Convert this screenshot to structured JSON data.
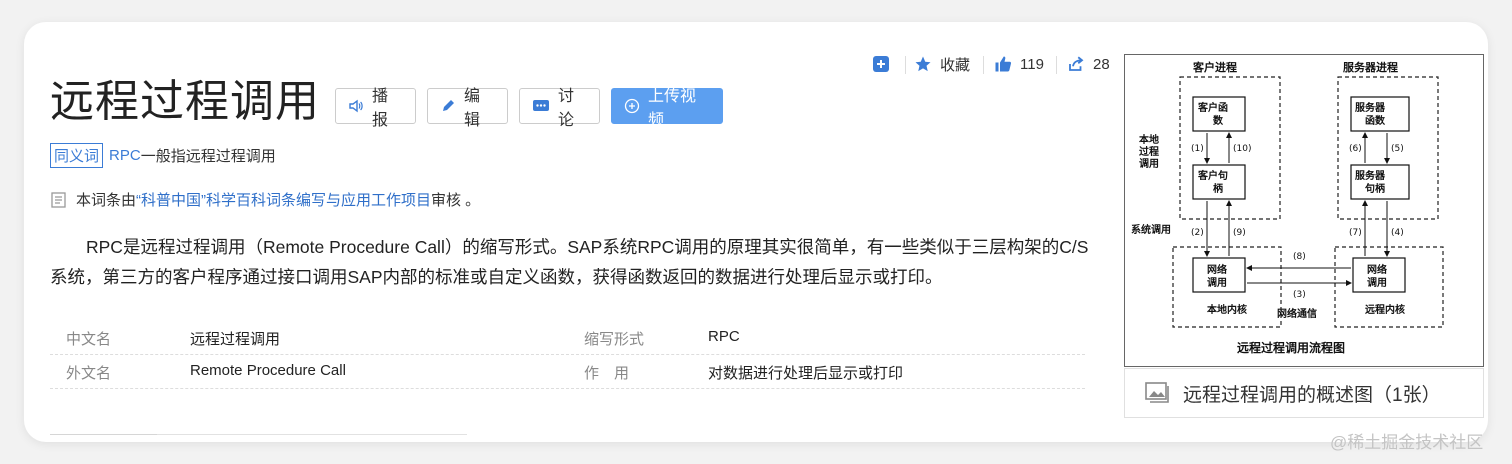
{
  "entry": {
    "title": "远程过程调用",
    "buttons": {
      "broadcast": "播报",
      "edit": "编辑",
      "discuss": "讨论",
      "upload_video": "上传视频"
    },
    "stats": {
      "collect_label": "收藏",
      "likes": "119",
      "shares": "28"
    }
  },
  "synonym": {
    "tag": "同义词",
    "link": "RPC",
    "text": "一般指远程过程调用"
  },
  "review": {
    "prefix": "本词条由",
    "link": "“科普中国”科学百科词条编写与应用工作项目",
    "suffix": " 审核 。"
  },
  "summary": "RPC是远程过程调用（Remote Procedure Call）的缩写形式。SAP系统RPC调用的原理其实很简单，有一些类似于三层构架的C/S系统，第三方的客户程序通过接口调用SAP内部的标准或自定义函数，获得函数返回的数据进行处理后显示或打印。",
  "basic_info": [
    {
      "k1": "中文名",
      "v1": "远程过程调用",
      "k2": "缩写形式",
      "v2": "RPC"
    },
    {
      "k1": "外文名",
      "v1": "Remote Procedure Call",
      "k2": "作　用",
      "v2": "对数据进行处理后显示或打印"
    }
  ],
  "figure": {
    "caption": "远程过程调用的概述图（1张）",
    "diagram": {
      "client_process": "客户进程",
      "server_process": "服务器进程",
      "local_call": "本地过程调用",
      "system_call": "系统调用",
      "client_function": "客户函数",
      "server_function": "服务器函数",
      "client_stub": "客户句柄",
      "server_stub": "服务器句柄",
      "network_call": "网络调用",
      "local_kernel": "本地内核",
      "remote_kernel": "远程内核",
      "network_comm": "网络通信",
      "flow_title": "远程过程调用流程图",
      "s1": "(1)",
      "s2": "(2)",
      "s3": "(3)",
      "s4": "(4)",
      "s5": "(5)",
      "s6": "(6)",
      "s7": "(7)",
      "s8": "(8)",
      "s9": "(9)",
      "s10": "(10)"
    }
  },
  "watermark": "@稀土掘金技术社区"
}
